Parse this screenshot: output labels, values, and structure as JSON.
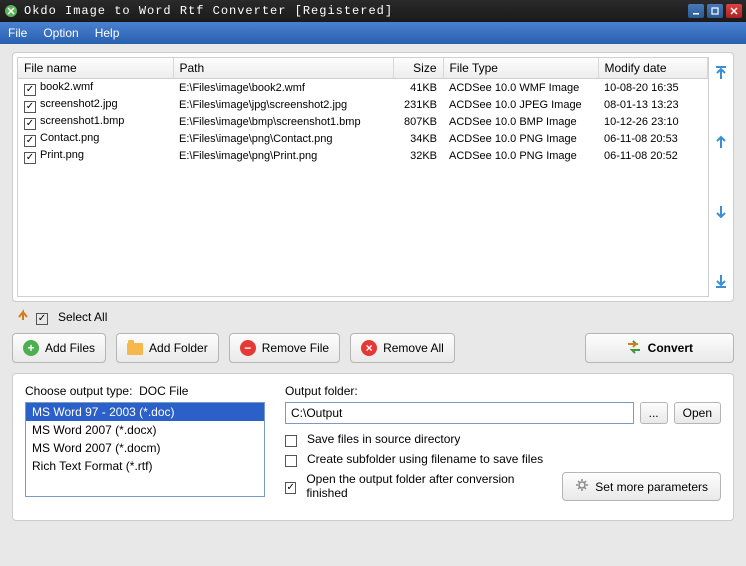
{
  "titlebar": {
    "text": "Okdo Image to Word Rtf Converter [Registered]"
  },
  "menu": {
    "file": "File",
    "option": "Option",
    "help": "Help"
  },
  "columns": {
    "name": "File name",
    "path": "Path",
    "size": "Size",
    "type": "File Type",
    "modify": "Modify date"
  },
  "rows": [
    {
      "checked": true,
      "name": "book2.wmf",
      "path": "E:\\Files\\image\\book2.wmf",
      "size": "41KB",
      "type": "ACDSee 10.0 WMF Image",
      "modify": "10-08-20 16:35"
    },
    {
      "checked": true,
      "name": "screenshot2.jpg",
      "path": "E:\\Files\\image\\jpg\\screenshot2.jpg",
      "size": "231KB",
      "type": "ACDSee 10.0 JPEG Image",
      "modify": "08-01-13 13:23"
    },
    {
      "checked": true,
      "name": "screenshot1.bmp",
      "path": "E:\\Files\\image\\bmp\\screenshot1.bmp",
      "size": "807KB",
      "type": "ACDSee 10.0 BMP Image",
      "modify": "10-12-26 23:10"
    },
    {
      "checked": true,
      "name": "Contact.png",
      "path": "E:\\Files\\image\\png\\Contact.png",
      "size": "34KB",
      "type": "ACDSee 10.0 PNG Image",
      "modify": "06-11-08 20:53"
    },
    {
      "checked": true,
      "name": "Print.png",
      "path": "E:\\Files\\image\\png\\Print.png",
      "size": "32KB",
      "type": "ACDSee 10.0 PNG Image",
      "modify": "06-11-08 20:52"
    }
  ],
  "selectAll": {
    "label": "Select All",
    "checked": true
  },
  "buttons": {
    "addFiles": "Add Files",
    "addFolder": "Add Folder",
    "removeFile": "Remove File",
    "removeAll": "Remove All",
    "convert": "Convert"
  },
  "outputType": {
    "label": "Choose output type:",
    "current": "DOC File",
    "options": [
      "MS Word 97 - 2003 (*.doc)",
      "MS Word 2007 (*.docx)",
      "MS Word 2007 (*.docm)",
      "Rich Text Format (*.rtf)"
    ],
    "selectedIndex": 0
  },
  "outputFolder": {
    "label": "Output folder:",
    "value": "C:\\Output",
    "browse": "...",
    "open": "Open"
  },
  "options": {
    "saveInSource": {
      "label": "Save files in source directory",
      "checked": false
    },
    "createSub": {
      "label": "Create subfolder using filename to save files",
      "checked": false
    },
    "openAfter": {
      "label": "Open the output folder after conversion finished",
      "checked": true
    }
  },
  "params": {
    "label": "Set more parameters"
  }
}
